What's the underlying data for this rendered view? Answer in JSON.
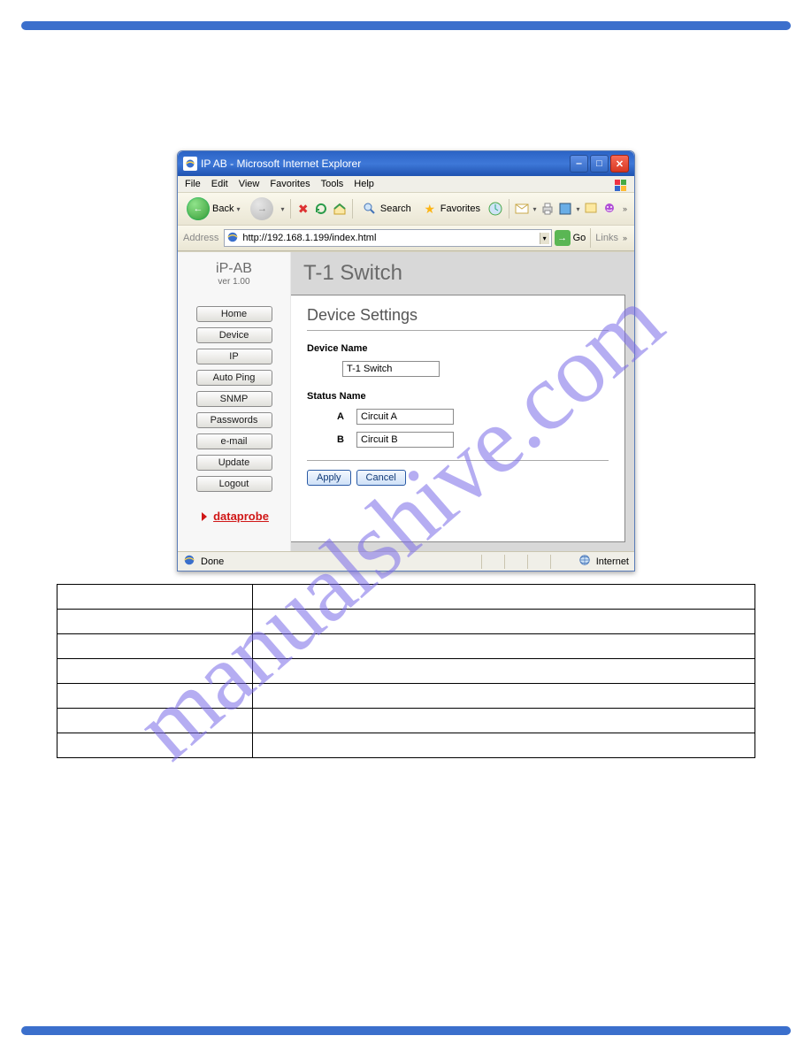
{
  "window": {
    "title": "IP AB - Microsoft Internet Explorer",
    "menu": [
      "File",
      "Edit",
      "View",
      "Favorites",
      "Tools",
      "Help"
    ],
    "toolbar": {
      "back": "Back",
      "search": "Search",
      "favorites": "Favorites"
    },
    "address_label": "Address",
    "address_value": "http://192.168.1.199/index.html",
    "go_label": "Go",
    "links_label": "Links",
    "status_left": "Done",
    "status_right": "Internet"
  },
  "sidebar": {
    "product": "iP-AB",
    "version": "ver 1.00",
    "items": [
      "Home",
      "Device",
      "IP",
      "Auto Ping",
      "SNMP",
      "Passwords",
      "e-mail",
      "Update",
      "Logout"
    ],
    "brand": "dataprobe"
  },
  "main": {
    "page_title": "T-1 Switch",
    "section_title": "Device Settings",
    "device_name_label": "Device Name",
    "device_name_value": "T-1 Switch",
    "status_name_label": "Status Name",
    "status": [
      {
        "letter": "A",
        "value": "Circuit A"
      },
      {
        "letter": "B",
        "value": "Circuit B"
      }
    ],
    "apply": "Apply",
    "cancel": "Cancel"
  },
  "watermark": "manualshive.com"
}
